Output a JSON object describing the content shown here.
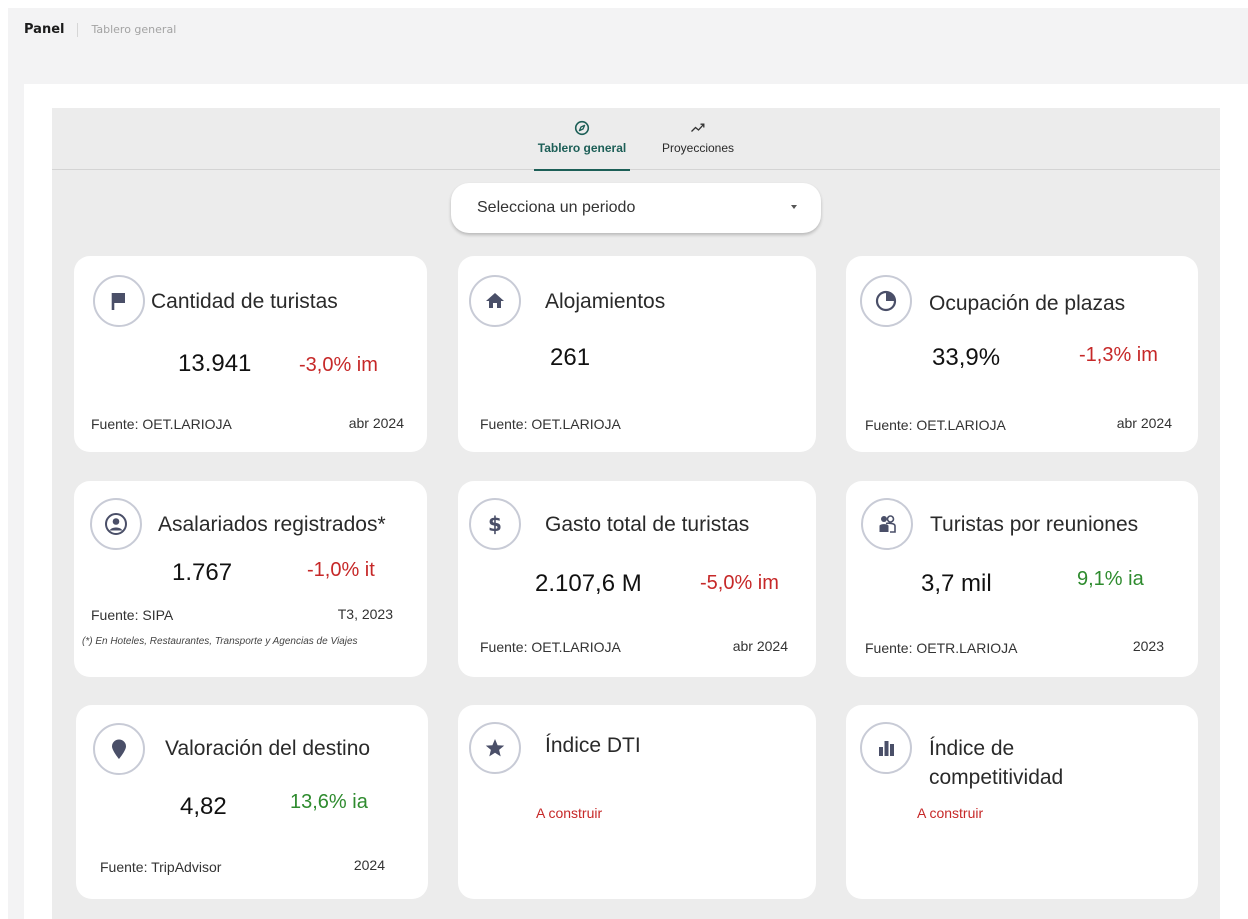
{
  "breadcrumb": {
    "root": "Panel",
    "current": "Tablero general"
  },
  "tabs": [
    {
      "label": "Tablero general",
      "icon": "compass-icon",
      "active": true
    },
    {
      "label": "Proyecciones",
      "icon": "trending-up-icon",
      "active": false
    }
  ],
  "period_select": {
    "placeholder": "Selecciona un periodo"
  },
  "colors": {
    "accent": "#1d5f57",
    "negative": "#c62828",
    "positive": "#2e8b2e",
    "icon": "#4a4f68"
  },
  "cards": {
    "turistas": {
      "icon": "flag-icon",
      "title": "Cantidad de turistas",
      "value": "13.941",
      "delta": "-3,0% im",
      "source": "Fuente: OET.LARIOJA",
      "date": "abr 2024"
    },
    "alojamientos": {
      "icon": "home-icon",
      "title": "Alojamientos",
      "value": "261",
      "source": "Fuente: OET.LARIOJA"
    },
    "ocupacion": {
      "icon": "pie-chart-icon",
      "title": "Ocupación de plazas",
      "value": "33,9%",
      "delta": "-1,3% im",
      "source": "Fuente: OET.LARIOJA",
      "date": "abr 2024"
    },
    "asalariados": {
      "icon": "user-circle-icon",
      "title": "Asalariados registrados*",
      "value": "1.767",
      "delta": "-1,0% it",
      "source": "Fuente: SIPA",
      "date": "T3, 2023",
      "footnote": "(*) En Hoteles, Restaurantes, Transporte y Agencias de Viajes"
    },
    "gasto": {
      "icon": "dollar-icon",
      "title": "Gasto total de turistas",
      "value": "2.107,6 M",
      "delta": "-5,0% im",
      "source": "Fuente: OET.LARIOJA",
      "date": "abr 2024"
    },
    "reuniones": {
      "icon": "group-icon",
      "title": "Turistas por reuniones",
      "value": "3,7 mil",
      "delta": "9,1% ia",
      "source": "Fuente: OETR.LARIOJA",
      "date": "2023"
    },
    "valoracion": {
      "icon": "map-pin-icon",
      "title": "Valoración del destino",
      "value": "4,82",
      "delta": "13,6% ia",
      "source": "Fuente: TripAdvisor",
      "date": "2024"
    },
    "dti": {
      "icon": "star-icon",
      "title": "Índice DTI",
      "status": "A construir"
    },
    "competitividad": {
      "icon": "bar-chart-icon",
      "title_line1": "Índice de",
      "title_line2": "competitividad",
      "status": "A construir"
    }
  }
}
